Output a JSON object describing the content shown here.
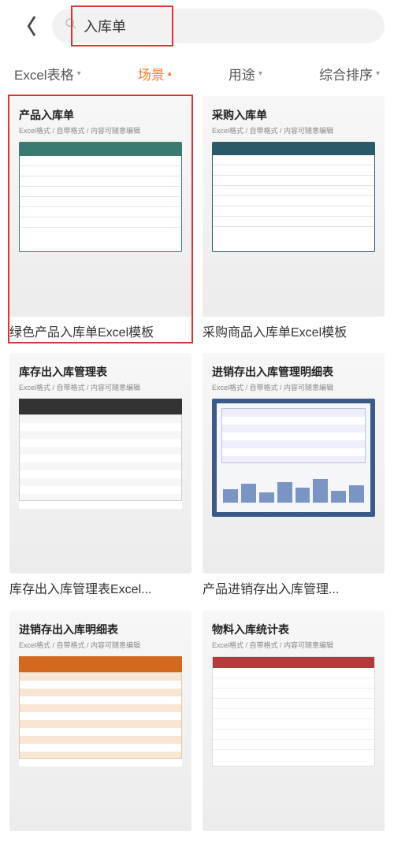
{
  "header": {
    "search_value": "入库单"
  },
  "tabs": {
    "items": [
      {
        "label": "Excel表格",
        "active": false
      },
      {
        "label": "场景",
        "active": true
      },
      {
        "label": "用途",
        "active": false
      },
      {
        "label": "综合排序",
        "active": false
      }
    ]
  },
  "templates": [
    {
      "thumb_title": "产品入库单",
      "thumb_sub": "Excel格式 / 自带格式 / 内容可随意编辑",
      "title": "绿色产品入库单Excel模板",
      "style": "green",
      "highlighted": true
    },
    {
      "thumb_title": "采购入库单",
      "thumb_sub": "Excel格式 / 自带格式 / 内容可随意编辑",
      "title": "采购商品入库单Excel模板",
      "style": "teal",
      "highlighted": false
    },
    {
      "thumb_title": "库存出入库管理表",
      "thumb_sub": "Excel格式 / 自带格式 / 内容可随意编辑",
      "title": "库存出入库管理表Excel...",
      "style": "dark",
      "highlighted": false
    },
    {
      "thumb_title": "进销存出入库管理明细表",
      "thumb_sub": "Excel格式 / 自带格式 / 内容可随意编辑",
      "title": "产品进销存出入库管理...",
      "style": "blue",
      "highlighted": false
    },
    {
      "thumb_title": "进销存出入库明细表",
      "thumb_sub": "Excel格式 / 自带格式 / 内容可随意编辑",
      "title": "",
      "style": "orange",
      "highlighted": false
    },
    {
      "thumb_title": "物料入库统计表",
      "thumb_sub": "Excel格式 / 自带格式 / 内容可随意编辑",
      "title": "",
      "style": "white",
      "highlighted": false
    }
  ]
}
